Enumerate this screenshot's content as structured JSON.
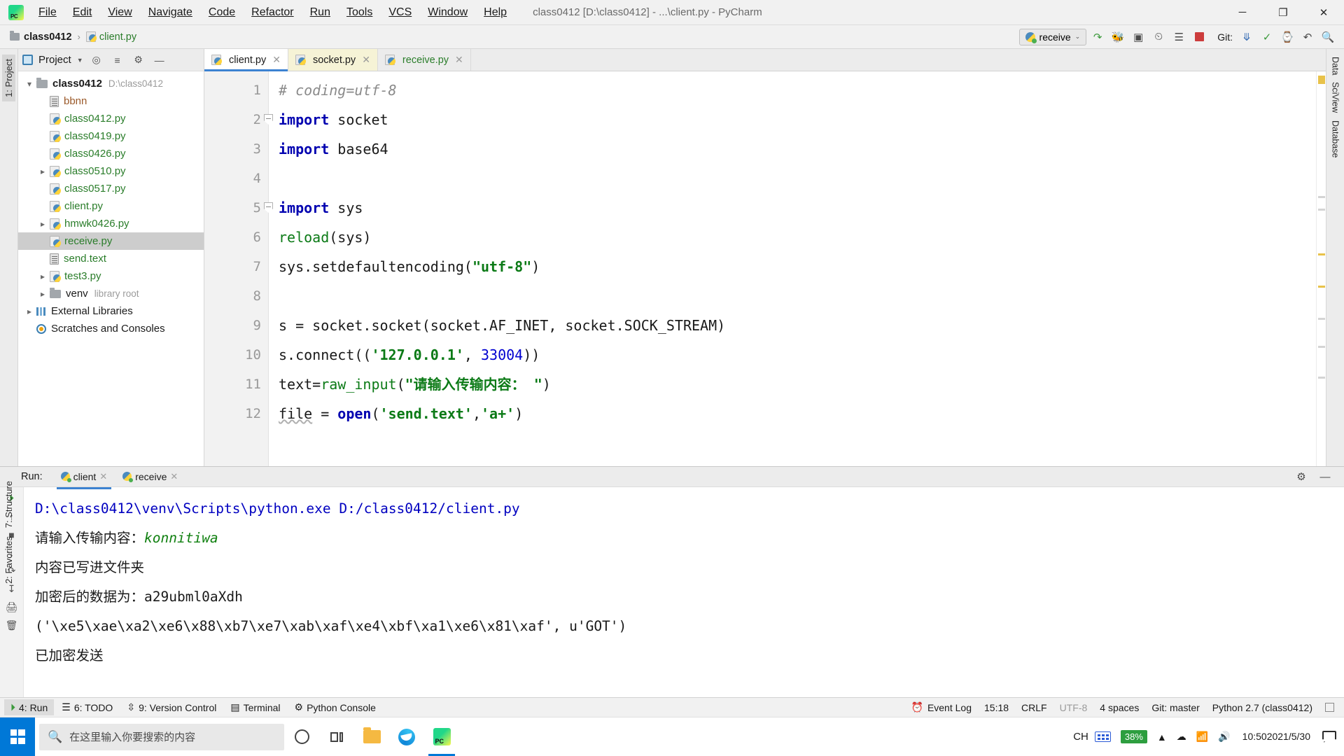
{
  "titlebar": {
    "app_icon": "pycharm-logo",
    "menus": [
      "File",
      "Edit",
      "View",
      "Navigate",
      "Code",
      "Refactor",
      "Run",
      "Tools",
      "VCS",
      "Window",
      "Help"
    ],
    "window_title": "class0412 [D:\\class0412] - ...\\client.py - PyCharm",
    "minimize": "─",
    "maximize": "❐",
    "close": "✕"
  },
  "breadcrumb": {
    "project": "class0412",
    "separator": "›",
    "file": "client.py"
  },
  "toolbar": {
    "run_config": "receive",
    "run_config_chevron": "⌄",
    "icons": [
      "rerun-icon",
      "debug-icon",
      "coverage-icon",
      "profile-icon",
      "concurrency-icon",
      "stop-icon"
    ],
    "git_label": "Git:",
    "git_icons": [
      "update-project-icon",
      "commit-icon",
      "history-icon",
      "rollback-icon",
      "search-everywhere-icon"
    ]
  },
  "left_rail": {
    "project_tab": "1: Project",
    "structure_tab": "7: Structure",
    "favorites_tab": "2: Favorites"
  },
  "right_rail": {
    "database_tab": "Database",
    "sciview_tab": "SciView",
    "datasource_tab": "Data"
  },
  "project_panel": {
    "title": "Project",
    "header_icons": [
      "locate-icon",
      "collapse-all-icon",
      "settings-icon",
      "hide-icon"
    ],
    "tree": [
      {
        "label": "class0412",
        "path": "D:\\class0412",
        "icon": "folder-icon",
        "depth": 0,
        "twisty": "open",
        "style": "bold",
        "selected": false
      },
      {
        "label": "bbnn",
        "path": "",
        "icon": "text-file-icon",
        "depth": 1,
        "twisty": "none",
        "style": "brown",
        "selected": false
      },
      {
        "label": "class0412.py",
        "path": "",
        "icon": "python-file-icon",
        "depth": 1,
        "twisty": "none",
        "style": "green",
        "selected": false
      },
      {
        "label": "class0419.py",
        "path": "",
        "icon": "python-file-icon",
        "depth": 1,
        "twisty": "none",
        "style": "green",
        "selected": false
      },
      {
        "label": "class0426.py",
        "path": "",
        "icon": "python-file-icon",
        "depth": 1,
        "twisty": "none",
        "style": "green",
        "selected": false
      },
      {
        "label": "class0510.py",
        "path": "",
        "icon": "python-file-icon",
        "depth": 1,
        "twisty": "closed",
        "style": "green",
        "selected": false
      },
      {
        "label": "class0517.py",
        "path": "",
        "icon": "python-file-icon",
        "depth": 1,
        "twisty": "none",
        "style": "green",
        "selected": false
      },
      {
        "label": "client.py",
        "path": "",
        "icon": "python-file-icon",
        "depth": 1,
        "twisty": "none",
        "style": "green",
        "selected": false
      },
      {
        "label": "hmwk0426.py",
        "path": "",
        "icon": "python-file-icon",
        "depth": 1,
        "twisty": "closed",
        "style": "green",
        "selected": false
      },
      {
        "label": "receive.py",
        "path": "",
        "icon": "python-file-icon",
        "depth": 1,
        "twisty": "none",
        "style": "green",
        "selected": true
      },
      {
        "label": "send.text",
        "path": "",
        "icon": "text-file-icon",
        "depth": 1,
        "twisty": "none",
        "style": "green",
        "selected": false
      },
      {
        "label": "test3.py",
        "path": "",
        "icon": "python-file-icon",
        "depth": 1,
        "twisty": "closed",
        "style": "green",
        "selected": false
      },
      {
        "label": "venv",
        "path": "library root",
        "icon": "folder-icon",
        "depth": 1,
        "twisty": "closed",
        "style": "plain",
        "selected": false
      },
      {
        "label": "External Libraries",
        "path": "",
        "icon": "library-icon",
        "depth": 0,
        "twisty": "closed",
        "style": "plain",
        "selected": false
      },
      {
        "label": "Scratches and Consoles",
        "path": "",
        "icon": "scratch-icon",
        "depth": 0,
        "twisty": "none",
        "style": "plain",
        "selected": false
      }
    ]
  },
  "editor": {
    "tabs": [
      {
        "label": "client.py",
        "state": "active"
      },
      {
        "label": "socket.py",
        "state": "modified"
      },
      {
        "label": "receive.py",
        "state": "normal"
      }
    ],
    "tab_close": "✕",
    "lines": [
      {
        "n": "1",
        "fold": false,
        "tokens": [
          {
            "t": "# coding=utf-8",
            "c": "cmt"
          }
        ]
      },
      {
        "n": "2",
        "fold": true,
        "tokens": [
          {
            "t": "import",
            "c": "kw"
          },
          {
            "t": " socket",
            "c": "plain"
          }
        ]
      },
      {
        "n": "3",
        "fold": false,
        "tokens": [
          {
            "t": "import",
            "c": "kw"
          },
          {
            "t": " base64",
            "c": "plain"
          }
        ]
      },
      {
        "n": "4",
        "fold": false,
        "tokens": []
      },
      {
        "n": "5",
        "fold": true,
        "tokens": [
          {
            "t": "import",
            "c": "kw"
          },
          {
            "t": " sys",
            "c": "plain"
          }
        ]
      },
      {
        "n": "6",
        "fold": false,
        "tokens": [
          {
            "t": "reload",
            "c": "fn"
          },
          {
            "t": "(sys)",
            "c": "plain"
          }
        ]
      },
      {
        "n": "7",
        "fold": false,
        "tokens": [
          {
            "t": "sys.setdefaultencoding(",
            "c": "plain"
          },
          {
            "t": "\"utf-8\"",
            "c": "str"
          },
          {
            "t": ")",
            "c": "plain"
          }
        ]
      },
      {
        "n": "8",
        "fold": false,
        "tokens": []
      },
      {
        "n": "9",
        "fold": false,
        "tokens": [
          {
            "t": "s = socket.socket(socket.AF_INET, socket.SOCK_STREAM)",
            "c": "plain"
          }
        ]
      },
      {
        "n": "10",
        "fold": false,
        "tokens": [
          {
            "t": "s.connect((",
            "c": "plain"
          },
          {
            "t": "'127.0.0.1'",
            "c": "str"
          },
          {
            "t": ", ",
            "c": "plain"
          },
          {
            "t": "33004",
            "c": "num"
          },
          {
            "t": "))",
            "c": "plain"
          }
        ]
      },
      {
        "n": "11",
        "fold": false,
        "tokens": [
          {
            "t": "text=",
            "c": "plain"
          },
          {
            "t": "raw_input",
            "c": "fn"
          },
          {
            "t": "(",
            "c": "plain"
          },
          {
            "t": "\"请输入传输内容： \"",
            "c": "str"
          },
          {
            "t": ")",
            "c": "plain"
          }
        ]
      },
      {
        "n": "12",
        "fold": false,
        "tokens": [
          {
            "t": "file",
            "c": "plain"
          },
          {
            "t": " = ",
            "c": "plain"
          },
          {
            "t": "open",
            "c": "kw"
          },
          {
            "t": "(",
            "c": "plain"
          },
          {
            "t": "'send.text'",
            "c": "str"
          },
          {
            "t": ",",
            "c": "plain"
          },
          {
            "t": "'a+'",
            "c": "str"
          },
          {
            "t": ")",
            "c": "plain"
          }
        ]
      }
    ]
  },
  "run_panel": {
    "label": "Run:",
    "tabs": [
      {
        "label": "client",
        "state": "active"
      },
      {
        "label": "receive",
        "state": "normal"
      }
    ],
    "tab_close": "✕",
    "header_icons": [
      "settings-icon",
      "hide-icon"
    ],
    "gutter_icons": [
      "rerun-icon",
      "up-icon",
      "stop-icon",
      "down-icon",
      "soft-wrap-icon",
      "scroll-to-end-icon",
      "print-icon",
      "clear-all-icon"
    ],
    "output": [
      {
        "segments": [
          {
            "t": "D:\\class0412\\venv\\Scripts\\python.exe D:/class0412/client.py",
            "c": "c-blue"
          }
        ]
      },
      {
        "segments": [
          {
            "t": "请输入传输内容：",
            "c": "c-black"
          },
          {
            "t": "konnitiwa",
            "c": "c-green-i"
          }
        ]
      },
      {
        "segments": [
          {
            "t": "内容已写进文件夹",
            "c": "c-black"
          }
        ]
      },
      {
        "segments": [
          {
            "t": "加密后的数据为：a29ubml0aXdh",
            "c": "c-black"
          }
        ]
      },
      {
        "segments": [
          {
            "t": "('\\xe5\\xae\\xa2\\xe6\\x88\\xb7\\xe7\\xab\\xaf\\xe4\\xbf\\xa1\\xe6\\x81\\xaf', u'GOT')",
            "c": "c-black"
          }
        ]
      },
      {
        "segments": [
          {
            "t": "已加密发送",
            "c": "c-black"
          }
        ]
      }
    ]
  },
  "statusbar": {
    "left_buttons": [
      {
        "label": "4: Run",
        "icon": "run-icon",
        "active": true
      },
      {
        "label": "6: TODO",
        "icon": "todo-icon",
        "active": false
      },
      {
        "label": "9: Version Control",
        "icon": "vcs-icon",
        "active": false
      },
      {
        "label": "Terminal",
        "icon": "terminal-icon",
        "active": false
      },
      {
        "label": "Python Console",
        "icon": "python-console-icon",
        "active": false
      }
    ],
    "event_log": "Event Log",
    "caret": "15:18",
    "line_sep": "CRLF",
    "encoding": "UTF-8",
    "indent": "4 spaces",
    "branch": "Git: master",
    "interpreter": "Python 2.7 (class0412)"
  },
  "taskbar": {
    "search_placeholder": "在这里输入你要搜索的内容",
    "search_icon": "magnifier-icon",
    "items": [
      {
        "name": "cortana-icon"
      },
      {
        "name": "task-view-icon"
      },
      {
        "name": "file-explorer-icon"
      },
      {
        "name": "edge-browser-icon"
      },
      {
        "name": "pycharm-taskbar-icon",
        "active": true
      }
    ],
    "ime_label": "CH",
    "battery_percent": "38%",
    "clock_time": "10:50",
    "clock_date": "2021/5/30",
    "tray_icons": [
      "chevron-up-icon",
      "network-icon",
      "volume-icon",
      "onedrive-icon"
    ],
    "notification_icon": "notification-icon"
  }
}
